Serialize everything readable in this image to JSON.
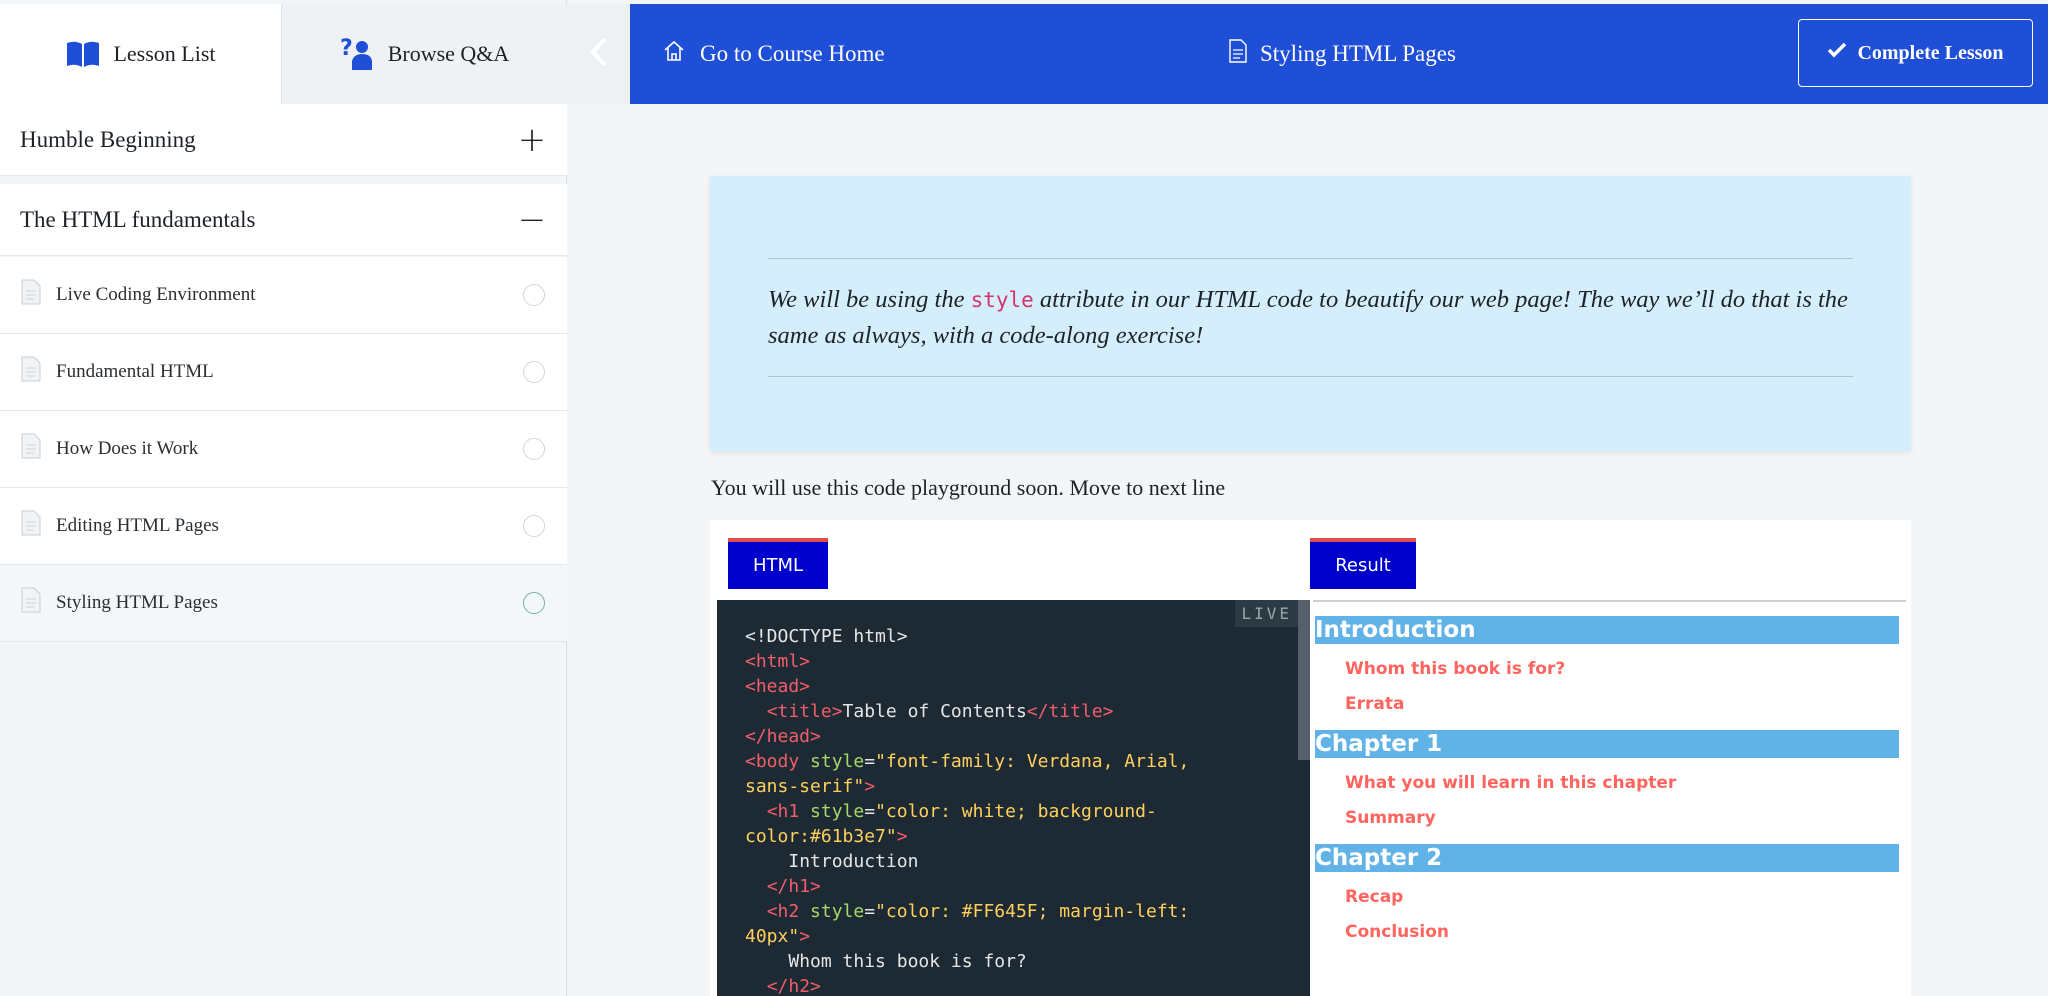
{
  "sidebar": {
    "tabs": [
      {
        "label": "Lesson List",
        "icon": "book-icon"
      },
      {
        "label": "Browse Q&A",
        "icon": "question-person-icon"
      }
    ],
    "sections": [
      {
        "title": "Humble Beginning",
        "toggle": "+"
      },
      {
        "title": "The HTML fundamentals",
        "toggle": "−"
      }
    ],
    "lessons": [
      {
        "label": "Live Coding Environment"
      },
      {
        "label": "Fundamental HTML"
      },
      {
        "label": "How Does it Work"
      },
      {
        "label": "Editing HTML Pages"
      },
      {
        "label": "Styling HTML Pages"
      }
    ]
  },
  "topbar": {
    "home_label": "Go to Course Home",
    "current_lesson": "Styling HTML Pages",
    "complete_label": "Complete Lesson",
    "accent": "#1f4fd6"
  },
  "main": {
    "note_before": "We will be using the ",
    "note_code": "style",
    "note_after": " attribute in our HTML code to beautify our web page! The way we’ll do that is the same as always, with a code-along exercise!",
    "intro": "You will use this code playground soon. Move to next line",
    "playground": {
      "html_tab": "HTML",
      "result_tab": "Result",
      "live_label": "LIVE"
    },
    "result": {
      "h1": [
        "Introduction",
        "Chapter 1",
        "Chapter 2"
      ],
      "h2": [
        "Whom this book is for?",
        "Errata",
        "What you will learn in this chapter",
        "Summary",
        "Recap",
        "Conclusion"
      ],
      "h1_bg": "#61b3e7",
      "h2_color": "#FF645F"
    }
  }
}
